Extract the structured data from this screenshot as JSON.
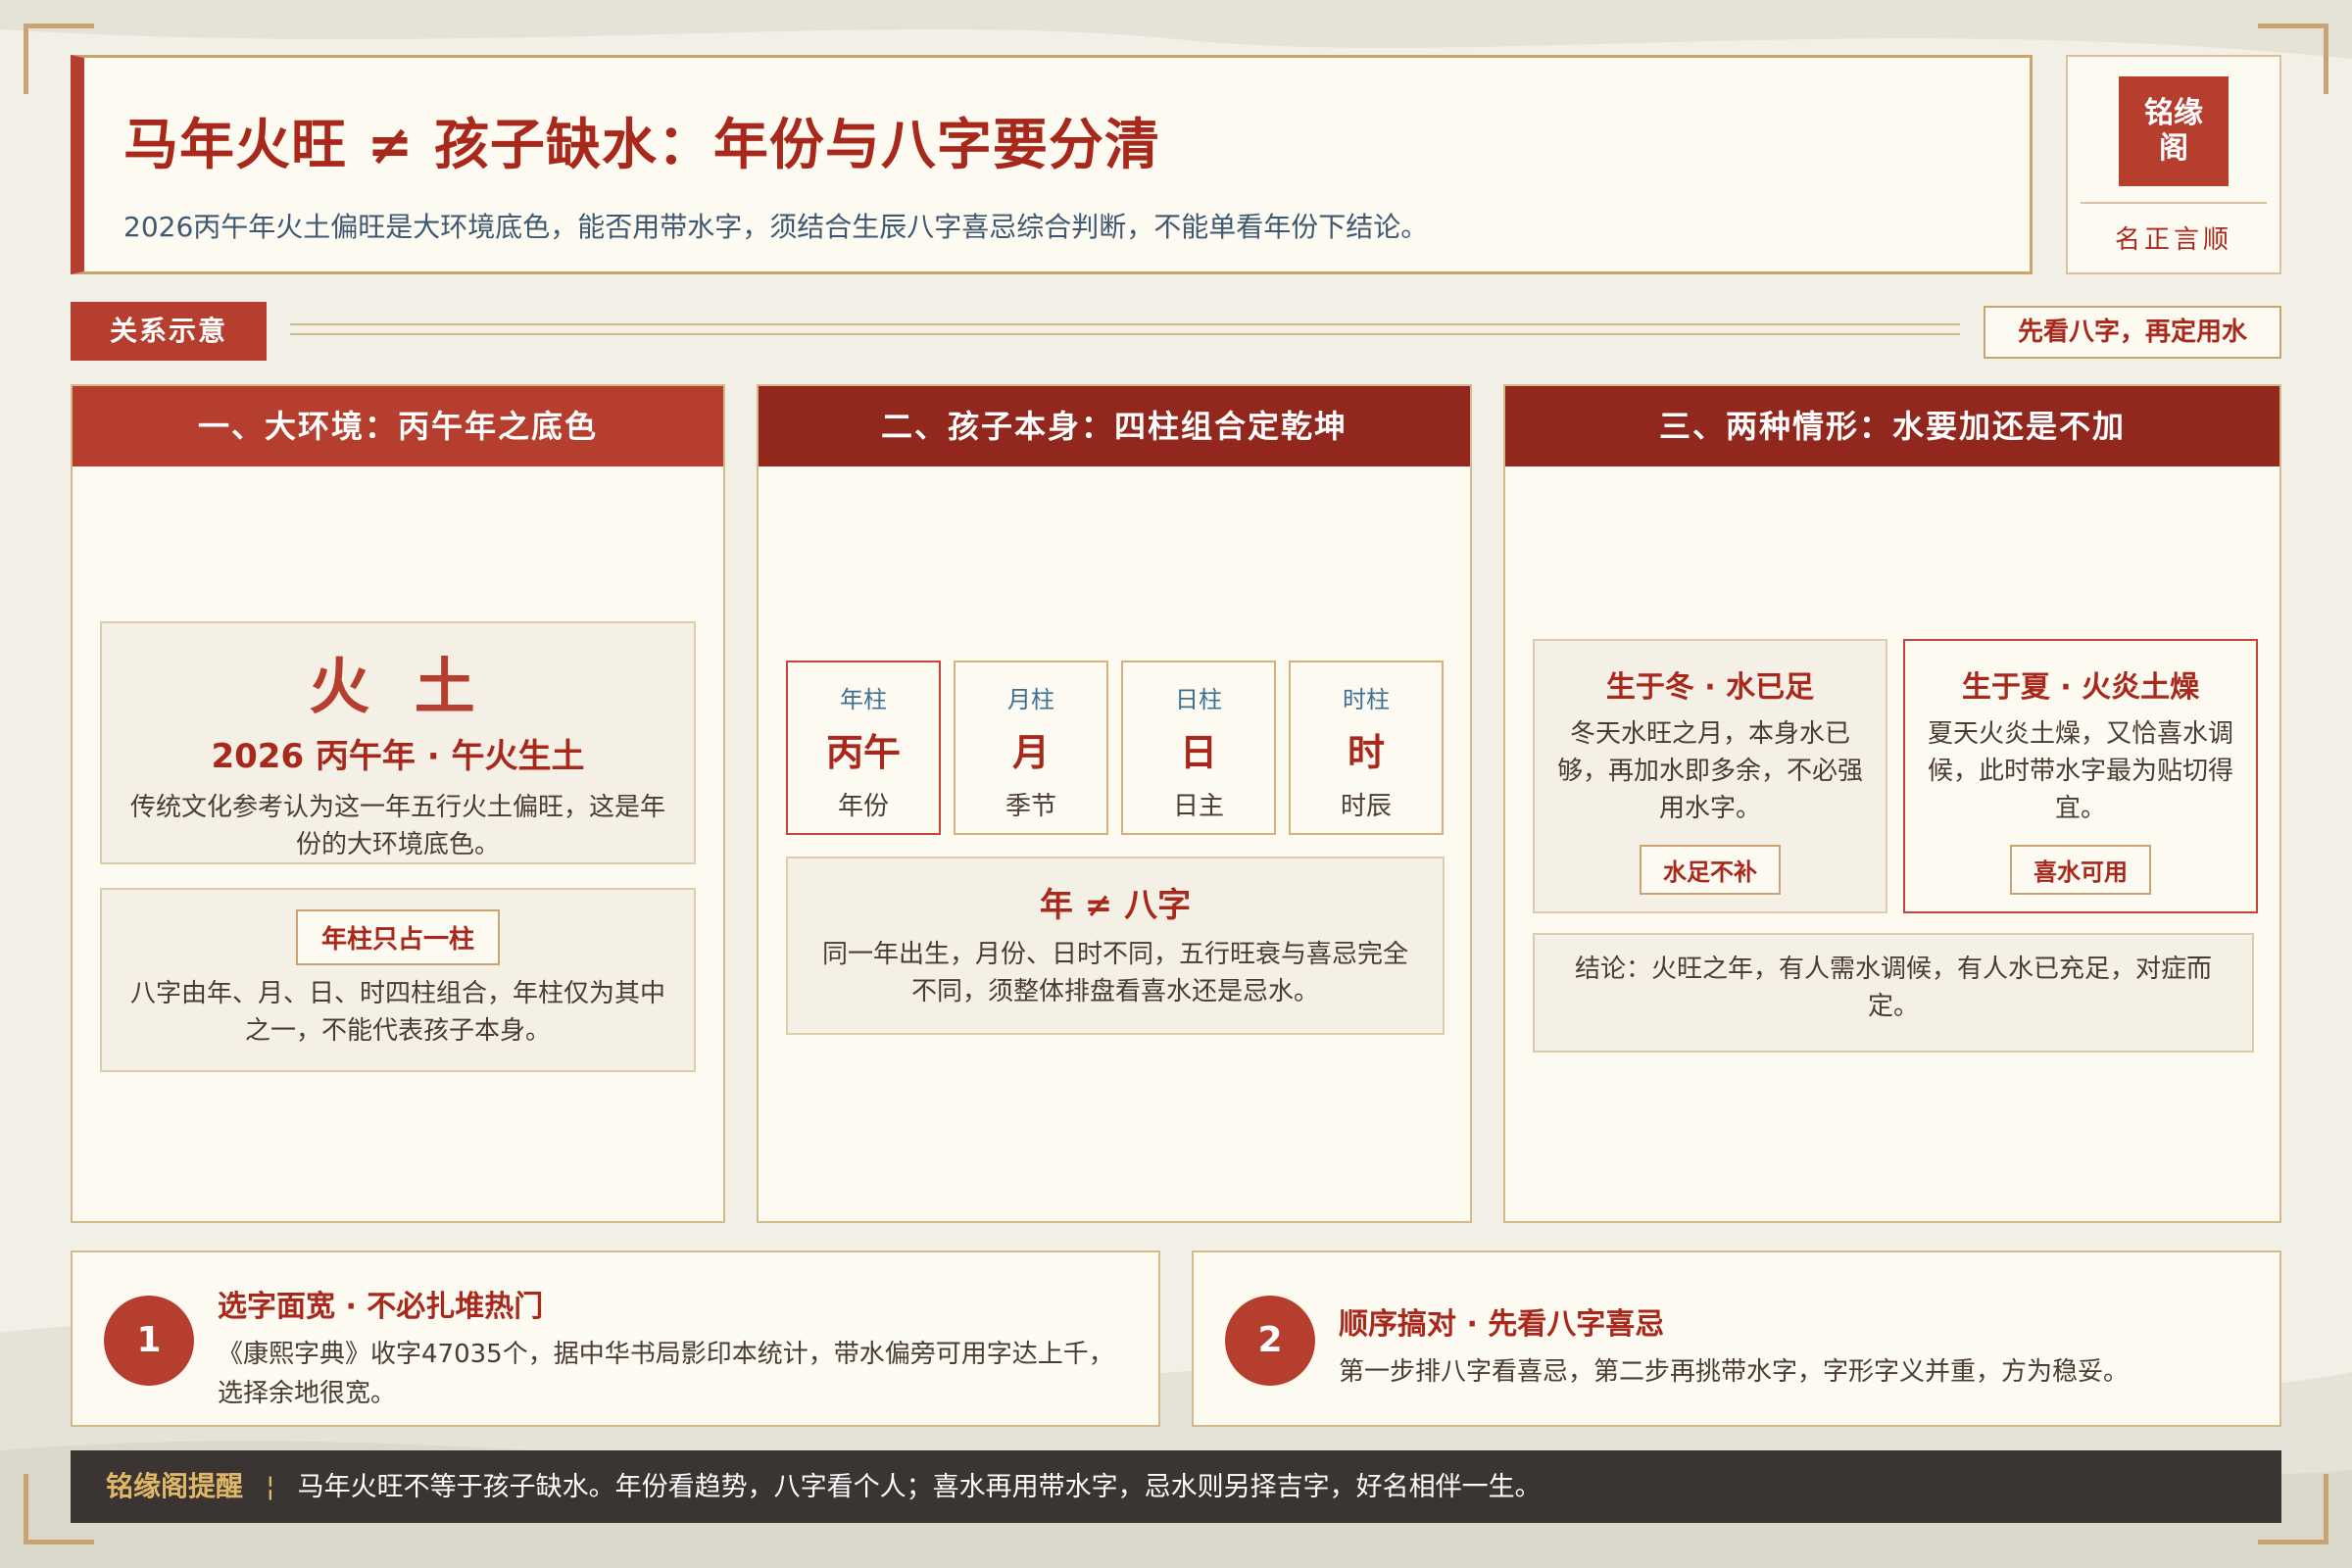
{
  "header": {
    "title": "马年火旺 ≠ 孩子缺水：年份与八字要分清",
    "subtitle": "2026丙午年火土偏旺是大环境底色，能否用带水字，须结合生辰八字喜忌综合判断，不能单看年份下结论。"
  },
  "brand": {
    "seal_line1": "铭缘",
    "seal_line2": "阁",
    "motto": "名正言顺"
  },
  "section": {
    "label": "关系示意",
    "tag": "先看八字，再定用水"
  },
  "panel1": {
    "heading": "一、大环境：丙午年之底色",
    "elements": "火 土",
    "year_line": "2026 丙午年 · 午火生土",
    "year_desc": "传统文化参考认为这一年五行火土偏旺，这是年份的大环境底色。",
    "pill": "年柱只占一柱",
    "pill_desc": "八字由年、月、日、时四柱组合，年柱仅为其中之一，不能代表孩子本身。"
  },
  "panel2": {
    "heading": "二、孩子本身：四柱组合定乾坤",
    "pillars": [
      {
        "label": "年柱",
        "main": "丙午",
        "sub": "年份"
      },
      {
        "label": "月柱",
        "main": "月",
        "sub": "季节"
      },
      {
        "label": "日柱",
        "main": "日",
        "sub": "日主"
      },
      {
        "label": "时柱",
        "main": "时",
        "sub": "时辰"
      }
    ],
    "neq_title": "年 ≠ 八字",
    "neq_desc": "同一年出生，月份、日时不同，五行旺衰与喜忌完全不同，须整体排盘看喜水还是忌水。"
  },
  "panel3": {
    "heading": "三、两种情形：水要加还是不加",
    "cases": [
      {
        "title": "生于冬 · 水已足",
        "desc": "冬天水旺之月，本身水已够，再加水即多余，不必强用水字。",
        "pill": "水足不补"
      },
      {
        "title": "生于夏 · 火炎土燥",
        "desc": "夏天火炎土燥，又恰喜水调候，此时带水字最为贴切得宜。",
        "pill": "喜水可用"
      }
    ],
    "conclusion": "结论：火旺之年，有人需水调候，有人水已充足，对症而定。"
  },
  "cards": [
    {
      "num": "1",
      "title": "选字面宽 · 不必扎堆热门",
      "desc": "《康熙字典》收字47035个，据中华书局影印本统计，带水偏旁可用字达上千，选择余地很宽。"
    },
    {
      "num": "2",
      "title": "顺序搞对 · 先看八字喜忌",
      "desc": "第一步排八字看喜忌，第二步再挑带水字，字形字义并重，方为稳妥。"
    }
  ],
  "footer": {
    "label": "铭缘阁提醒",
    "separator": "¦",
    "text": "马年火旺不等于孩子缺水。年份看趋势，八字看个人；喜水再用带水字，忌水则另择吉字，好名相伴一生。"
  },
  "colors": {
    "accent_red": "#b63e2e",
    "dark_red": "#91271d",
    "gold_border": "#c9a472",
    "footer_bg": "#3a3532"
  }
}
